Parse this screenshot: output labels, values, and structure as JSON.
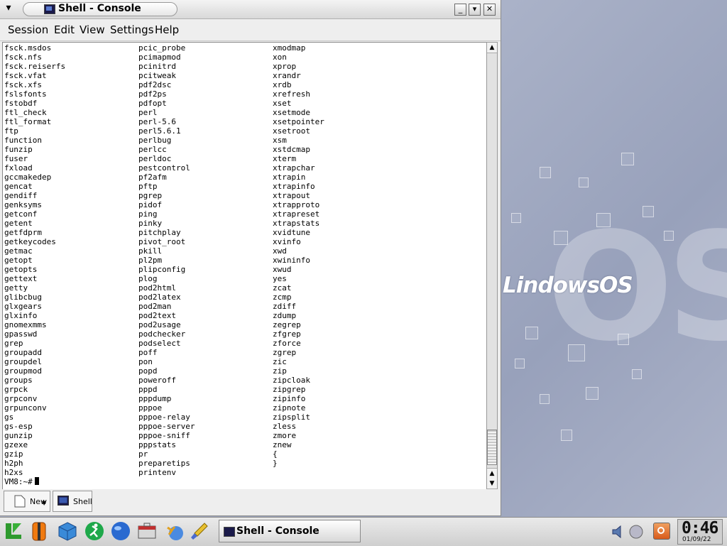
{
  "window": {
    "title": "Shell - Console",
    "menu": [
      "Session",
      "Edit",
      "View",
      "Settings",
      "Help"
    ]
  },
  "console": {
    "col1": [
      "fsck.msdos",
      "fsck.nfs",
      "fsck.reiserfs",
      "fsck.vfat",
      "fsck.xfs",
      "fslsfonts",
      "fstobdf",
      "ftl_check",
      "ftl_format",
      "ftp",
      "function",
      "funzip",
      "fuser",
      "fxload",
      "gccmakedep",
      "gencat",
      "gendiff",
      "genksyms",
      "getconf",
      "getent",
      "getfdprm",
      "getkeycodes",
      "getmac",
      "getopt",
      "getopts",
      "gettext",
      "getty",
      "glibcbug",
      "glxgears",
      "glxinfo",
      "gnomexmms",
      "gpasswd",
      "grep",
      "groupadd",
      "groupdel",
      "groupmod",
      "groups",
      "grpck",
      "grpconv",
      "grpunconv",
      "gs",
      "gs-esp",
      "gunzip",
      "gzexe",
      "gzip",
      "h2ph",
      "h2xs"
    ],
    "col2": [
      "pcic_probe",
      "pcimapmod",
      "pcinitrd",
      "pcitweak",
      "pdf2dsc",
      "pdf2ps",
      "pdfopt",
      "perl",
      "perl-5.6",
      "perl5.6.1",
      "perlbug",
      "perlcc",
      "perldoc",
      "pestcontrol",
      "pf2afm",
      "pftp",
      "pgrep",
      "pidof",
      "ping",
      "pinky",
      "pitchplay",
      "pivot_root",
      "pkill",
      "pl2pm",
      "plipconfig",
      "plog",
      "pod2html",
      "pod2latex",
      "pod2man",
      "pod2text",
      "pod2usage",
      "podchecker",
      "podselect",
      "poff",
      "pon",
      "popd",
      "poweroff",
      "pppd",
      "pppdump",
      "pppoe",
      "pppoe-relay",
      "pppoe-server",
      "pppoe-sniff",
      "pppstats",
      "pr",
      "preparetips",
      "printenv"
    ],
    "col3": [
      "xmodmap",
      "xon",
      "xprop",
      "xrandr",
      "xrdb",
      "xrefresh",
      "xset",
      "xsetmode",
      "xsetpointer",
      "xsetroot",
      "xsm",
      "xstdcmap",
      "xterm",
      "xtrapchar",
      "xtrapin",
      "xtrapinfo",
      "xtrapout",
      "xtrapproto",
      "xtrapreset",
      "xtrapstats",
      "xvidtune",
      "xvinfo",
      "xwd",
      "xwininfo",
      "xwud",
      "yes",
      "zcat",
      "zcmp",
      "zdiff",
      "zdump",
      "zegrep",
      "zfgrep",
      "zforce",
      "zgrep",
      "zic",
      "zip",
      "zipcloak",
      "zipgrep",
      "zipinfo",
      "zipnote",
      "zipsplit",
      "zless",
      "zmore",
      "znew",
      "{",
      "}"
    ],
    "prompt": "VM8:~#"
  },
  "session_tabs": {
    "new_label": "New",
    "shell_label": "Shell"
  },
  "desktop": {
    "logo_text": "LindowsOS",
    "big_text": "OS"
  },
  "taskbar": {
    "task_label": "Shell - Console",
    "clock_time": "0:46",
    "clock_date": "01/09/22"
  },
  "colors": {
    "console_bg": "#ffffff",
    "title_bg": "#e6e6e6",
    "desktop_bg": "#a4acc4"
  },
  "icons": [
    "lindows-start-icon",
    "life-vest-icon",
    "cube-icon",
    "running-man-icon",
    "globe-icon",
    "toolbox-icon",
    "runner-network-icon",
    "paintbrush-icon",
    "speaker-icon",
    "network-icon",
    "power-icon"
  ]
}
